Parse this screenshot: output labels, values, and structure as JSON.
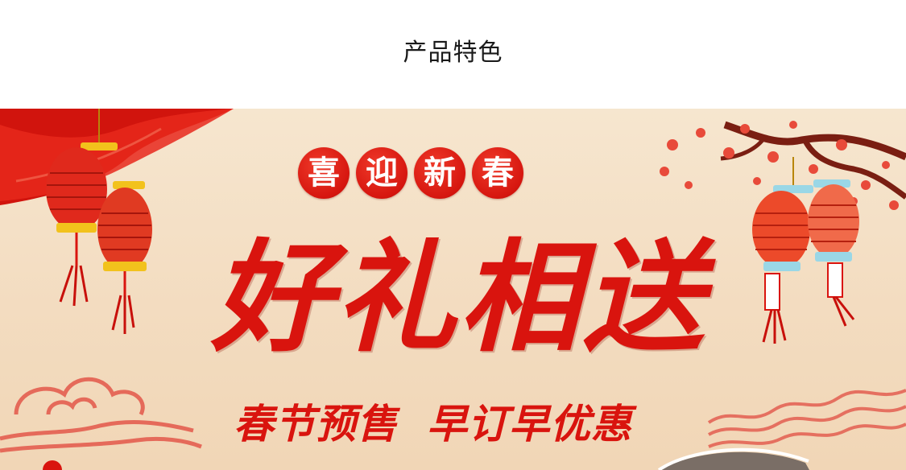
{
  "section": {
    "title": "产品特色"
  },
  "banner": {
    "greeting_chars": [
      "喜",
      "迎",
      "新",
      "春"
    ],
    "main_slogan": "好礼相送",
    "promo_left": "春节预售",
    "promo_right": "早订早优惠",
    "colors": {
      "background": "#f4e1c6",
      "accent_red": "#d9140e",
      "lantern_red": "#e0291c",
      "lantern_gold": "#f2c21c",
      "lantern_blue": "#9ad7e6",
      "blossom": "#e84a3a",
      "branch": "#7a1e12"
    }
  }
}
